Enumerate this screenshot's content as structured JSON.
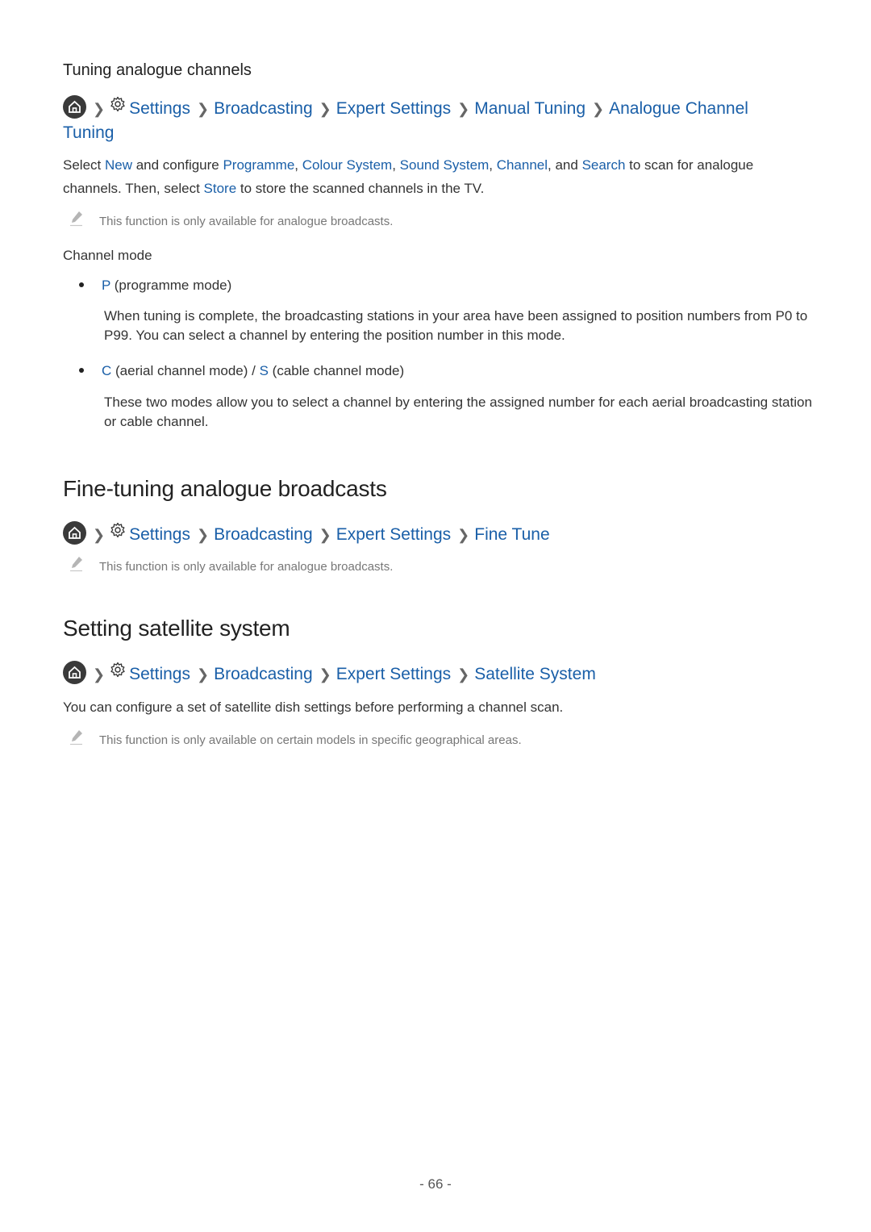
{
  "section1": {
    "subheading": "Tuning analogue channels",
    "breadcrumb": [
      "Settings",
      "Broadcasting",
      "Expert Settings",
      "Manual Tuning",
      "Analogue Channel",
      "Tuning"
    ],
    "para": {
      "t1": "Select ",
      "new": "New",
      "t2": " and configure ",
      "programme": "Programme",
      "c1": ", ",
      "colour": "Colour System",
      "c2": ", ",
      "sound": "Sound System",
      "c3": ", ",
      "channel": "Channel",
      "t3": ", and ",
      "search": "Search",
      "t4": " to scan for analogue",
      "t5": "channels. Then, select ",
      "store": "Store",
      "t6": " to store the scanned channels in the TV."
    },
    "note": "This function is only available for analogue broadcasts.",
    "channel_mode_label": "Channel mode",
    "bullets": [
      {
        "key": "P",
        "rest": " (programme mode)",
        "desc": "When tuning is complete, the broadcasting stations in your area have been assigned to position numbers from P0 to P99. You can select a channel by entering the position number in this mode."
      },
      {
        "key": "C",
        "mid": " (aerial channel mode) / ",
        "key2": "S",
        "rest": " (cable channel mode)",
        "desc": "These two modes allow you to select a channel by entering the assigned number for each aerial broadcasting station or cable channel."
      }
    ]
  },
  "section2": {
    "heading": "Fine-tuning analogue broadcasts",
    "breadcrumb": [
      "Settings",
      "Broadcasting",
      "Expert Settings",
      "Fine Tune"
    ],
    "note": "This function is only available for analogue broadcasts."
  },
  "section3": {
    "heading": "Setting satellite system",
    "breadcrumb": [
      "Settings",
      "Broadcasting",
      "Expert Settings",
      "Satellite System"
    ],
    "para": "You can configure a set of satellite dish settings before performing a channel scan.",
    "note": "This function is only available on certain models in specific geographical areas."
  },
  "footer": {
    "page_number": "- 66 -"
  }
}
